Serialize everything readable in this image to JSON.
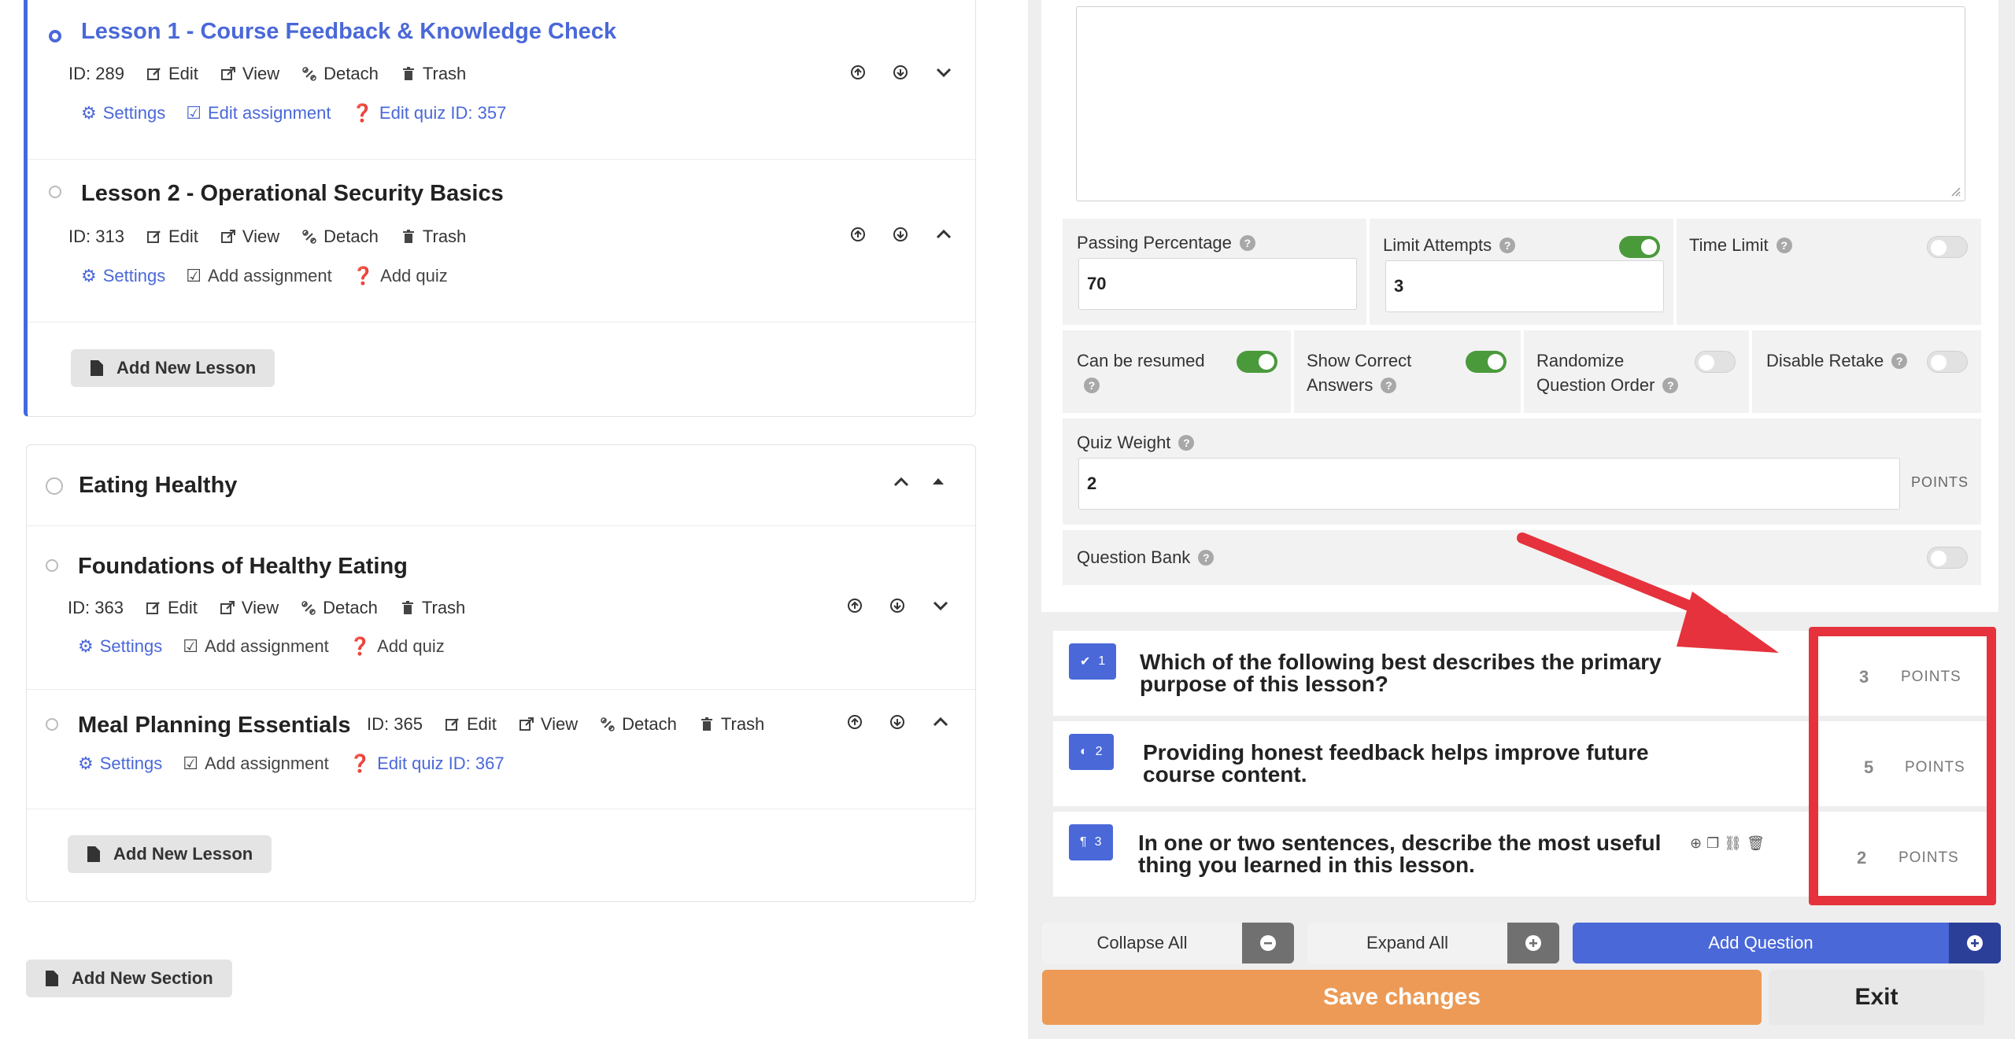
{
  "left": {
    "lessons_card1": [
      {
        "title": "Lesson 1 - Course Feedback & Knowledge Check",
        "id": "ID: 289",
        "actions": [
          "Edit",
          "View",
          "Detach",
          "Trash"
        ],
        "links": [
          "Settings",
          "Edit assignment",
          "Edit quiz ID: 357"
        ]
      },
      {
        "title": "Lesson 2 - Operational Security Basics",
        "id": "ID: 313",
        "actions": [
          "Edit",
          "View",
          "Detach",
          "Trash"
        ],
        "links": [
          "Settings",
          "Add assignment",
          "Add quiz"
        ]
      }
    ],
    "add_new_lesson": "Add New Lesson",
    "section2": {
      "title": "Eating Healthy",
      "lessons": [
        {
          "title": "Foundations of Healthy Eating",
          "id": "ID: 363",
          "actions": [
            "Edit",
            "View",
            "Detach",
            "Trash"
          ],
          "links": [
            "Settings",
            "Add assignment",
            "Add quiz"
          ]
        },
        {
          "title": "Meal Planning Essentials",
          "id": "ID: 365",
          "actions": [
            "Edit",
            "View",
            "Detach",
            "Trash"
          ],
          "links": [
            "Settings",
            "Add assignment",
            "Edit quiz ID: 367"
          ]
        }
      ]
    },
    "add_new_section": "Add New Section"
  },
  "quiz": {
    "passing_percentage": {
      "label": "Passing Percentage",
      "value": "70"
    },
    "limit_attempts": {
      "label": "Limit Attempts",
      "value": "3",
      "enabled": true
    },
    "time_limit": {
      "label": "Time Limit",
      "enabled": false
    },
    "can_be_resumed": {
      "label": "Can be resumed",
      "enabled": true
    },
    "show_correct_answers": {
      "label_line1": "Show Correct",
      "label_line2": "Answers",
      "enabled": true
    },
    "randomize": {
      "label_line1": "Randomize",
      "label_line2": "Question Order",
      "enabled": false
    },
    "disable_retake": {
      "label": "Disable Retake",
      "enabled": false
    },
    "quiz_weight": {
      "label": "Quiz Weight",
      "value": "2",
      "unit": "POINTS"
    },
    "question_bank": {
      "label": "Question Bank",
      "enabled": false
    }
  },
  "questions": [
    {
      "number": "1",
      "icon": "checkbox-icon",
      "line1": "Which of the following best describes the primary",
      "line2": "purpose of this lesson?",
      "points": "3",
      "unit": "POINTS"
    },
    {
      "number": "2",
      "icon": "toggle-icon",
      "line1": "Providing honest feedback helps improve future",
      "line2": "course content.",
      "points": "5",
      "unit": "POINTS"
    },
    {
      "number": "3",
      "icon": "paragraph-icon",
      "line1": "In one or two sentences, describe the most useful",
      "line2": "thing you learned in this lesson.",
      "points": "2",
      "unit": "POINTS"
    }
  ],
  "toolbar": {
    "collapse_all": "Collapse All",
    "expand_all": "Expand All",
    "add_question": "Add Question",
    "save_changes": "Save changes",
    "exit": "Exit"
  },
  "colors": {
    "accent": "#4a68d8",
    "save": "#ec9a55",
    "toggle_on": "#4a9a3c",
    "highlight": "#e5323c"
  }
}
